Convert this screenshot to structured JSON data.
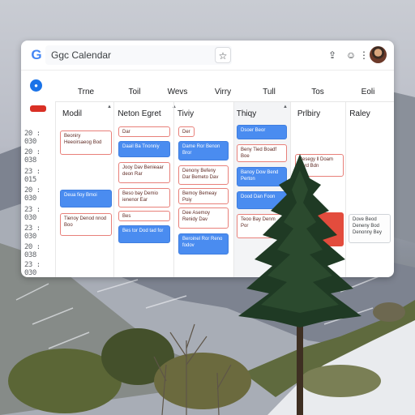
{
  "app": {
    "title": "Ggc Calendar",
    "logo_letter": "G"
  },
  "toolbar": {
    "star_icon": "star-icon",
    "share_icon": "share-icon",
    "face_icon": "face-icon",
    "menu_icon": "more-vert-icon"
  },
  "days": [
    "Trne",
    "Toil",
    "Wevs",
    "Virry",
    "Tull",
    "Tos",
    "Eoli"
  ],
  "columns": [
    "Modil",
    "Neton Egret",
    "Tiviy",
    "Thiqy",
    "Prlbiry",
    "Raley"
  ],
  "times": [
    "20 : 030",
    "20 : 038",
    "23 : 015",
    "20 : 030",
    "23 : 030",
    "23 : 030",
    "20 : 038",
    "23 : 030",
    "23 : 036"
  ],
  "events": {
    "modil": [
      {
        "text": "Beoniry Heeoirsaeog Bod",
        "style": "outline"
      },
      {
        "text": "Deua fioy Bmoi",
        "style": "blue"
      },
      {
        "text": "Tienoy Denod nnod Boo",
        "style": "outline"
      }
    ],
    "neton": [
      {
        "text": "Dar",
        "style": "outline"
      },
      {
        "text": "Daail Ba Tnonniy",
        "style": "blue"
      },
      {
        "text": "Jooy Dav Benieaar deon Rar",
        "style": "outline"
      },
      {
        "text": "Beso bay Demio ienenor Ear",
        "style": "outline"
      },
      {
        "text": "Bes",
        "style": "outline"
      },
      {
        "text": "Bes tor Dod tad for",
        "style": "blue"
      }
    ],
    "tiviy": [
      {
        "text": "Der",
        "style": "outline"
      },
      {
        "text": "Dame Ror Benon Bror",
        "style": "blue"
      },
      {
        "text": "Denony Befeny Dar Bemeto Dav",
        "style": "outline"
      },
      {
        "text": "Bemoy Bemeay Poiy",
        "style": "outline"
      },
      {
        "text": "Dee Asemoy Renidy Dav",
        "style": "outline"
      },
      {
        "text": "Beroinel Ror Reno fodov",
        "style": "blue"
      }
    ],
    "thiqy": [
      {
        "text": "Dsoer Beor",
        "style": "blue"
      },
      {
        "text": "Beny Tied Boadf Boe",
        "style": "outline"
      },
      {
        "text": "Banoy Dow Bend Perton",
        "style": "blue"
      },
      {
        "text": "Dood Dan Foon",
        "style": "blue"
      },
      {
        "text": "Teoo Bay Denm Por",
        "style": "outline"
      }
    ],
    "prlbiry": [
      {
        "text": "Besegy ll Doam oard Bdn",
        "style": "outline"
      },
      {
        "text": "",
        "style": "red"
      }
    ],
    "raley": [
      {
        "text": "Dove Beod Deneny Bod Denonny Bey",
        "style": "gray"
      }
    ]
  }
}
